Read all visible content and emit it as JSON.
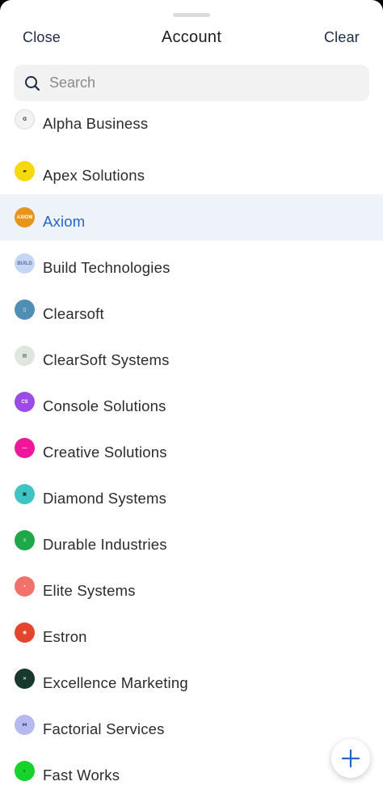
{
  "header": {
    "close_label": "Close",
    "title": "Account",
    "clear_label": "Clear"
  },
  "search": {
    "placeholder": "Search",
    "value": ""
  },
  "accounts": [
    {
      "name": "Alpha Business",
      "logo_bg": "#f3f3f3",
      "logo_fg": "#555555",
      "logo_mark": "ᗡ",
      "selected": false
    },
    {
      "name": "Apex Solutions",
      "logo_bg": "#f5d90a",
      "logo_fg": "#2a2a2a",
      "logo_mark": "▰",
      "selected": false
    },
    {
      "name": "Axiom",
      "logo_bg": "#e8941c",
      "logo_fg": "#ffffff",
      "logo_mark": "AXIOM",
      "selected": true
    },
    {
      "name": "Build Technologies",
      "logo_bg": "#c6d6f5",
      "logo_fg": "#5a6fa0",
      "logo_mark": "BUILD",
      "selected": false
    },
    {
      "name": "Clearsoft",
      "logo_bg": "#4f8fb3",
      "logo_fg": "#ffffff",
      "logo_mark": "▯",
      "selected": false
    },
    {
      "name": "ClearSoft Systems",
      "logo_bg": "#dfe6e0",
      "logo_fg": "#4a5a4a",
      "logo_mark": "▤",
      "selected": false
    },
    {
      "name": "Console Solutions",
      "logo_bg": "#9b4be8",
      "logo_fg": "#ffffff",
      "logo_mark": "CS",
      "selected": false
    },
    {
      "name": "Creative Solutions",
      "logo_bg": "#f0169a",
      "logo_fg": "#ffffff",
      "logo_mark": "—",
      "selected": false
    },
    {
      "name": "Diamond Systems",
      "logo_bg": "#3fc4c4",
      "logo_fg": "#1a2a2a",
      "logo_mark": "▣",
      "selected": false
    },
    {
      "name": "Durable Industries",
      "logo_bg": "#1ea84a",
      "logo_fg": "#ffffff",
      "logo_mark": "≡",
      "selected": false
    },
    {
      "name": "Elite Systems",
      "logo_bg": "#f2716b",
      "logo_fg": "#ffffff",
      "logo_mark": "•",
      "selected": false
    },
    {
      "name": "Estron",
      "logo_bg": "#e4452c",
      "logo_fg": "#ffffff",
      "logo_mark": "◉",
      "selected": false
    },
    {
      "name": "Excellence Marketing",
      "logo_bg": "#17382c",
      "logo_fg": "#ffffff",
      "logo_mark": "✕",
      "selected": false
    },
    {
      "name": "Factorial Services",
      "logo_bg": "#b7b9f2",
      "logo_fg": "#2a2a5a",
      "logo_mark": "⋈",
      "selected": false
    },
    {
      "name": "Fast Works",
      "logo_bg": "#16d22a",
      "logo_fg": "#0a3a10",
      "logo_mark": "◐",
      "selected": false
    }
  ],
  "fab": {
    "icon": "plus-icon",
    "color": "#2764c7"
  }
}
